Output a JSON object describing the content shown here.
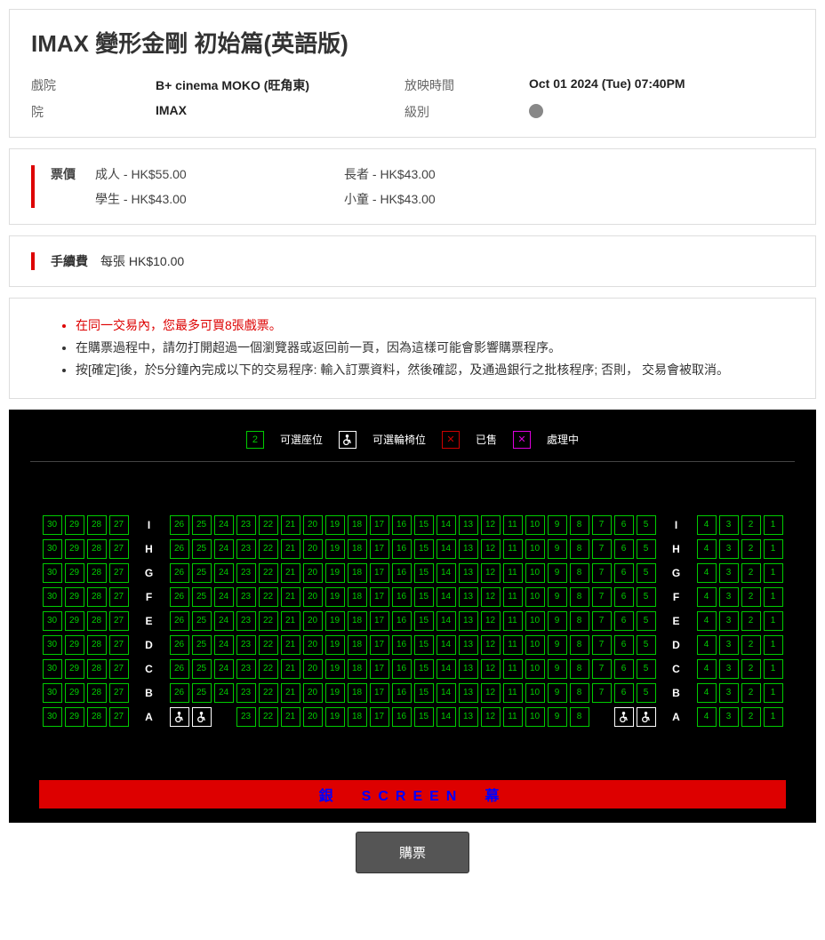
{
  "movie_title": "IMAX 變形金剛 初始篇(英語版)",
  "info": {
    "cinema_label": "戲院",
    "cinema_value": "B+ cinema MOKO (旺角東)",
    "showtime_label": "放映時間",
    "showtime_value": "Oct 01 2024 (Tue) 07:40PM",
    "house_label": "院",
    "house_value": "IMAX",
    "rating_label": "級別"
  },
  "pricing": {
    "label": "票價",
    "adult": "成人 - HK$55.00",
    "senior": "長者 - HK$43.00",
    "student": "學生 - HK$43.00",
    "child": "小童 - HK$43.00"
  },
  "fee": {
    "label": "手續費",
    "value": "每張 HK$10.00"
  },
  "notes": {
    "n1": "在同一交易內，您最多可買8張戲票。",
    "n2": "在購票過程中，請勿打開超過一個瀏覽器或返回前一頁，因為這樣可能會影響購票程序。",
    "n3": "按[確定]後，於5分鐘內完成以下的交易程序: 輸入訂票資料，然後確認，及通過銀行之批核程序; 否則， 交易會被取消。"
  },
  "legend": {
    "avail_num": "2",
    "avail": "可選座位",
    "wheel": "可選輪椅位",
    "sold_sym": "✕",
    "sold": "已售",
    "proc_sym": "✕",
    "proc": "處理中"
  },
  "seat_map": {
    "left_block": [
      30,
      29,
      28,
      27
    ],
    "center_block": [
      26,
      25,
      24,
      23,
      22,
      21,
      20,
      19,
      18,
      17,
      16,
      15,
      14,
      13,
      12,
      11,
      10,
      9,
      8,
      7,
      6,
      5
    ],
    "center_block_A": [
      23,
      22,
      21,
      20,
      19,
      18,
      17,
      16,
      15,
      14,
      13,
      12,
      11,
      10,
      9,
      8
    ],
    "right_block": [
      4,
      3,
      2,
      1
    ],
    "rows": [
      "I",
      "H",
      "G",
      "F",
      "E",
      "D",
      "C",
      "B",
      "A"
    ]
  },
  "screen_label": "銀　SCREEN　幕",
  "buy_label": "購票"
}
